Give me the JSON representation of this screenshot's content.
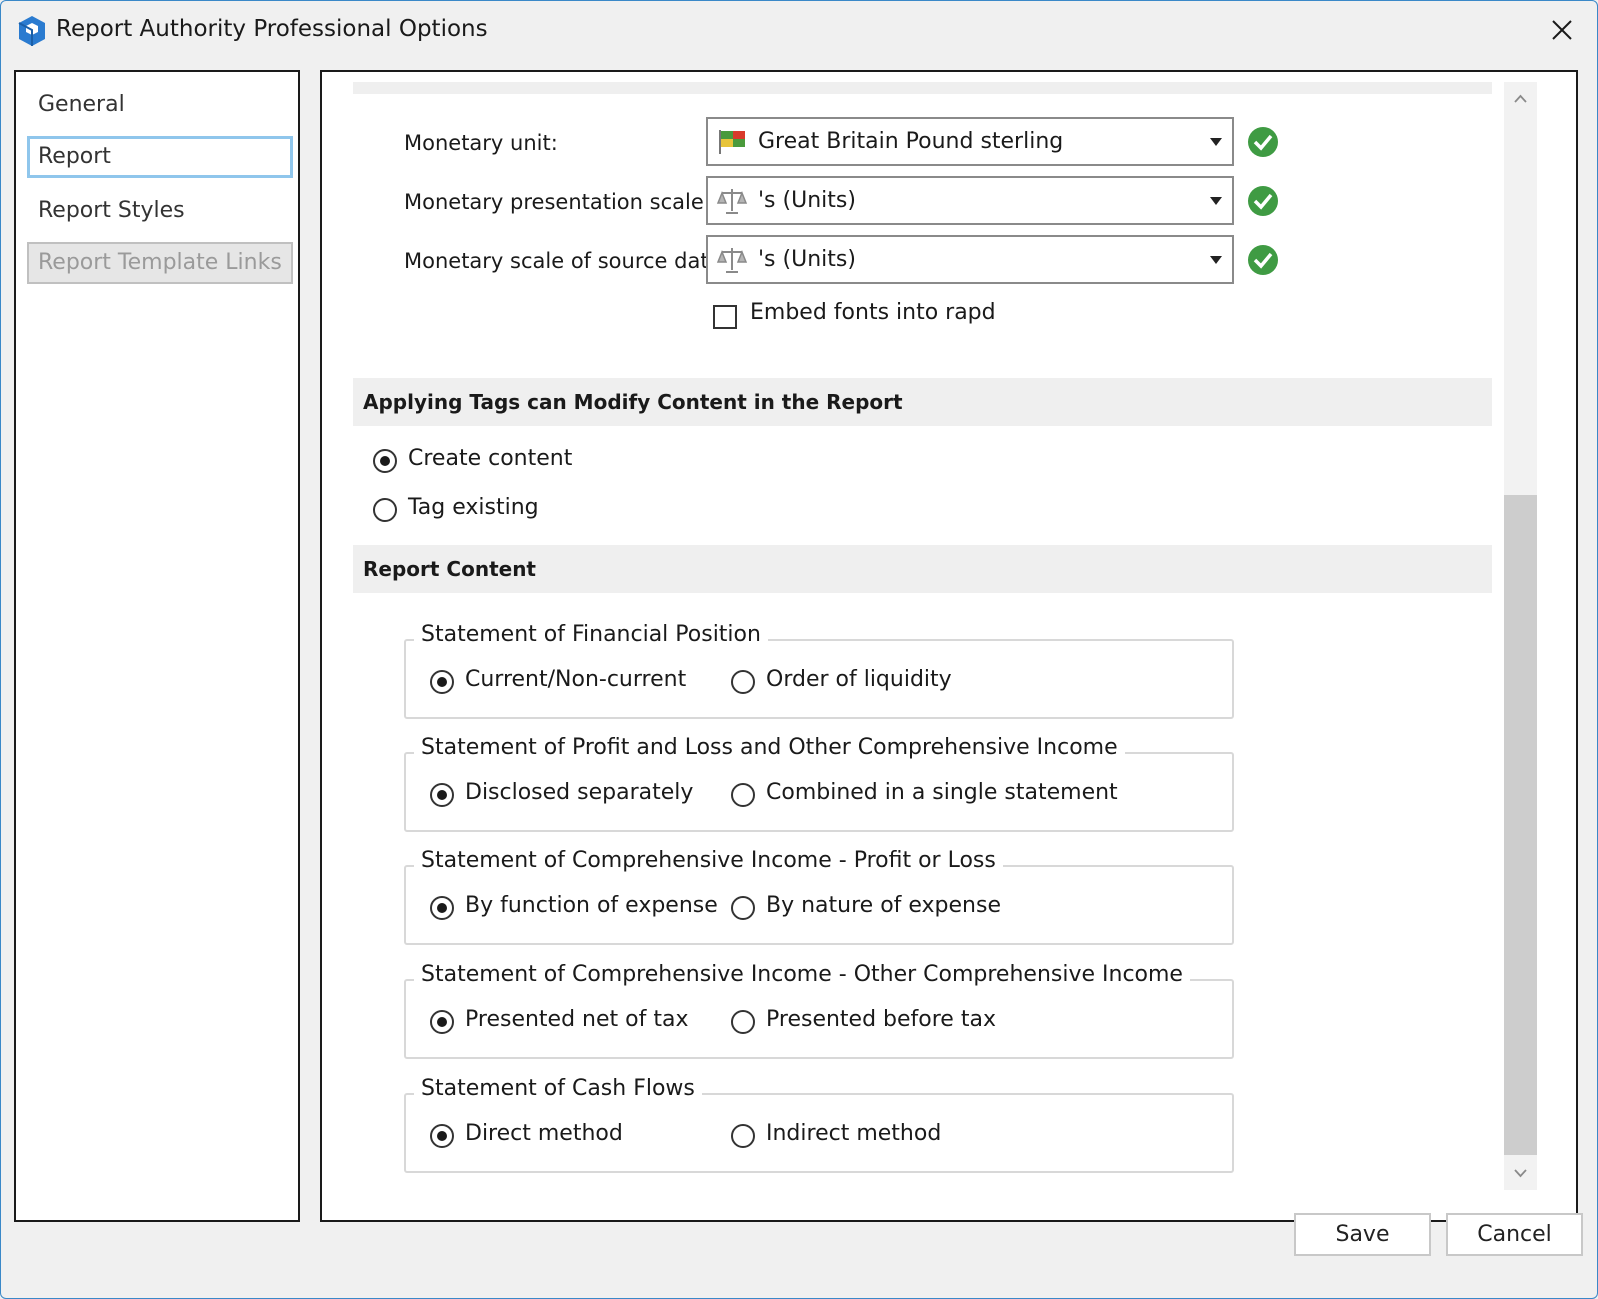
{
  "window": {
    "title": "Report Authority Professional Options"
  },
  "nav": {
    "items": [
      {
        "label": "General",
        "state": "normal"
      },
      {
        "label": "Report",
        "state": "selected"
      },
      {
        "label": "Report Styles",
        "state": "normal"
      },
      {
        "label": "Report Template Links",
        "state": "disabled"
      }
    ]
  },
  "settings": {
    "monetary_unit": {
      "label": "Monetary unit:",
      "value": "Great Britain Pound sterling",
      "icon": "flag-icon"
    },
    "presentation_scale": {
      "label": "Monetary presentation scale:",
      "value": "'s (Units)",
      "icon": "scales-icon"
    },
    "source_scale": {
      "label": "Monetary scale of source data:",
      "value": "'s (Units)",
      "icon": "scales-icon"
    },
    "embed_fonts": {
      "label": "Embed fonts into rapd",
      "checked": false
    }
  },
  "tags_section": {
    "title": "Applying Tags can Modify Content in the Report",
    "options": [
      {
        "label": "Create content",
        "checked": true
      },
      {
        "label": "Tag existing",
        "checked": false
      }
    ]
  },
  "content_section": {
    "title": "Report Content",
    "groups": [
      {
        "title": "Statement of Financial Position",
        "options": [
          "Current/Non-current",
          "Order of liquidity"
        ],
        "selected": 0
      },
      {
        "title": "Statement of Profit and Loss and Other Comprehensive Income",
        "options": [
          "Disclosed separately",
          "Combined in a single statement"
        ],
        "selected": 0
      },
      {
        "title": "Statement of Comprehensive Income - Profit or Loss",
        "options": [
          "By function of expense",
          "By nature of expense"
        ],
        "selected": 0
      },
      {
        "title": "Statement of Comprehensive Income - Other Comprehensive Income",
        "options": [
          "Presented net of tax",
          "Presented before tax"
        ],
        "selected": 0
      },
      {
        "title": "Statement of Cash Flows",
        "options": [
          "Direct method",
          "Indirect method"
        ],
        "selected": 0
      }
    ]
  },
  "buttons": {
    "save": "Save",
    "cancel": "Cancel"
  },
  "colors": {
    "accent": "#8fc6ec",
    "ok_green": "#3f9b43",
    "logo_blue": "#2a7bd0"
  }
}
